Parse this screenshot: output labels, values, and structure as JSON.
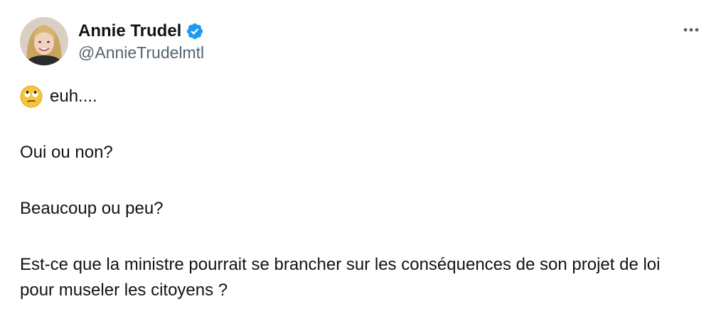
{
  "author": {
    "display_name": "Annie Trudel",
    "handle": "@AnnieTrudelmtl",
    "verified": true,
    "verified_badge_color": "#1d9bf0",
    "avatar_icon": "user-photo"
  },
  "menu": {
    "icon": "more-horizontal-icon"
  },
  "tweet": {
    "emoji": "face-with-rolling-eyes",
    "line1": "euh....",
    "line2": "Oui ou non?",
    "line3": "Beaucoup ou peu?",
    "line4": "Est-ce que la ministre pourrait se brancher sur les conséquences de son projet de loi pour museler les citoyens ?"
  },
  "colors": {
    "text": "#0f1419",
    "secondary_text": "#536471",
    "accent": "#1d9bf0"
  }
}
